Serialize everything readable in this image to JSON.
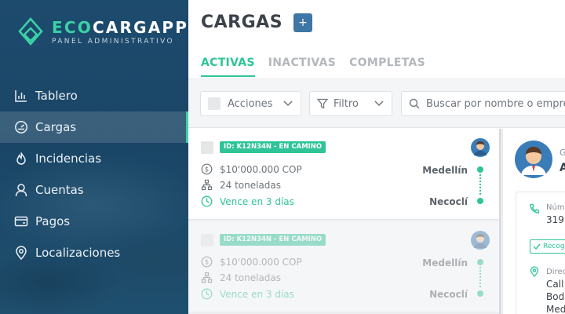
{
  "brand": {
    "name_eco": "ECO",
    "name_rest": "CARGAPP",
    "subtitle": "PANEL ADMINISTRATIVO",
    "accent": "#3bd1a6"
  },
  "sidebar": {
    "items": [
      {
        "label": "Tablero",
        "icon": "bar-chart-icon",
        "active": false
      },
      {
        "label": "Cargas",
        "icon": "gauge-icon",
        "active": true
      },
      {
        "label": "Incidencias",
        "icon": "flame-icon",
        "active": false
      },
      {
        "label": "Cuentas",
        "icon": "user-icon",
        "active": false
      },
      {
        "label": "Pagos",
        "icon": "wallet-icon",
        "active": false
      },
      {
        "label": "Localizaciones",
        "icon": "map-pin-icon",
        "active": false
      }
    ]
  },
  "header": {
    "title": "CARGAS",
    "add_label": "+"
  },
  "tabs": [
    {
      "label": "ACTIVAS",
      "active": true
    },
    {
      "label": "INACTIVAS",
      "active": false
    },
    {
      "label": "COMPLETAS",
      "active": false
    }
  ],
  "toolbar": {
    "actions_label": "Acciones",
    "filter_label": "Filtro",
    "search_placeholder": "Buscar por nombre o empresa"
  },
  "cards": [
    {
      "badge": "ID: K12N34N - EN CAMINO",
      "price": "$10'000.000 COP",
      "weight": "24 toneladas",
      "due": "Vence en 3 días",
      "origin": "Medellín",
      "destination": "Necoclí"
    },
    {
      "badge": "ID: K12N34N - EN CAMINO",
      "price": "$10'000.000 COP",
      "weight": "24 toneladas",
      "due": "Vence en 3 días",
      "origin": "Medellín",
      "destination": "Necoclí"
    }
  ],
  "detail": {
    "name_prefix": "G",
    "name_initial": "A",
    "phone_label": "Núm",
    "phone_value": "319",
    "tag_label": "Recog",
    "address_label": "Direc",
    "address_lines": [
      "Call",
      "Bod",
      "Med"
    ]
  },
  "colors": {
    "green": "#2ec498",
    "blue_button": "#3f76a6",
    "sidebar_bg": "#1d4b6e"
  }
}
